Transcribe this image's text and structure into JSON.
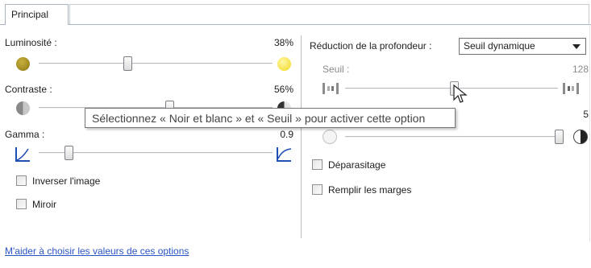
{
  "tabs": {
    "principal": "Principal"
  },
  "left": {
    "brightness": {
      "label": "Luminosité :",
      "value": "38%",
      "level": 0.38
    },
    "contrast": {
      "label": "Contraste :",
      "value": "56%",
      "level": 0.56
    },
    "gamma": {
      "label": "Gamma :",
      "value": "0.9"
    },
    "invert": {
      "label": "Inverser l'image",
      "checked": false
    },
    "mirror": {
      "label": "Miroir",
      "checked": false
    }
  },
  "right": {
    "depth_reduction": {
      "label": "Réduction de la profondeur :",
      "selected": "Seuil dynamique"
    },
    "threshold": {
      "label": "Seuil :",
      "value": "128"
    },
    "second_value": "5",
    "despeckle": {
      "label": "Déparasitage",
      "checked": false
    },
    "fill_margins": {
      "label": "Remplir les marges",
      "checked": false
    }
  },
  "tooltip": "Sélectionnez « Noir et blanc » et « Seuil » pour activer cette option",
  "help_link": "M'aider à choisir les valeurs de ces options",
  "colors": {
    "brightness_dark": "#9c8a1f",
    "brightness_light": "#f2df1a",
    "link": "#2a55c6",
    "divider": "#b9bec5"
  }
}
